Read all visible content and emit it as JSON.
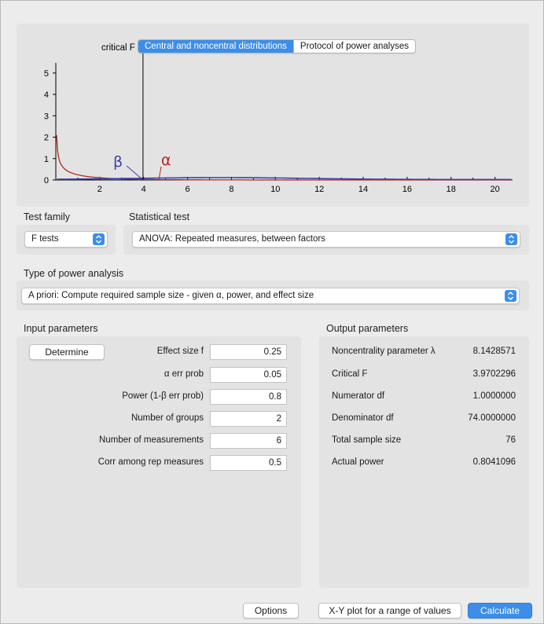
{
  "tabs": [
    {
      "label": "Central and noncentral distributions",
      "active": true
    },
    {
      "label": "Protocol of power analyses",
      "active": false
    }
  ],
  "plot": {
    "critical_label": "critical F = 3.9702",
    "beta_symbol": "β",
    "alpha_symbol": "α",
    "x_ticks": [
      "2",
      "4",
      "6",
      "8",
      "10",
      "12",
      "14",
      "16",
      "18",
      "20"
    ],
    "y_ticks": [
      "0",
      "1",
      "2",
      "3",
      "4",
      "5"
    ],
    "critical_value": 3.9702,
    "x_range": [
      0,
      20.8
    ],
    "y_range": [
      0,
      5.4
    ],
    "colors": {
      "central": "#b02a1e",
      "noncentral": "#3b3fa8",
      "axis": "#000000"
    }
  },
  "test_family": {
    "label": "Test family",
    "value": "F tests"
  },
  "statistical_test": {
    "label": "Statistical test",
    "value": "ANOVA: Repeated measures, between factors"
  },
  "power_analysis": {
    "label": "Type of power analysis",
    "value": "A priori: Compute required sample size - given α, power, and effect size"
  },
  "input": {
    "title": "Input parameters",
    "determine_label": "Determine",
    "rows": [
      {
        "label": "Effect size f",
        "value": "0.25"
      },
      {
        "label": "α err prob",
        "value": "0.05"
      },
      {
        "label": "Power (1-β err prob)",
        "value": "0.8"
      },
      {
        "label": "Number of groups",
        "value": "2"
      },
      {
        "label": "Number of measurements",
        "value": "6"
      },
      {
        "label": "Corr among rep measures",
        "value": "0.5"
      }
    ]
  },
  "output": {
    "title": "Output parameters",
    "rows": [
      {
        "label": "Noncentrality parameter λ",
        "value": "8.1428571"
      },
      {
        "label": "Critical F",
        "value": "3.9702296"
      },
      {
        "label": "Numerator df",
        "value": "1.0000000"
      },
      {
        "label": "Denominator df",
        "value": "74.0000000"
      },
      {
        "label": "Total sample size",
        "value": "76"
      },
      {
        "label": "Actual power",
        "value": "0.8041096"
      }
    ]
  },
  "footer": {
    "options_label": "Options",
    "xy_plot_label": "X-Y plot for a range of values",
    "calculate_label": "Calculate"
  },
  "colors": {
    "accent": "#3c8ee8",
    "panel": "#e3e3e3"
  }
}
